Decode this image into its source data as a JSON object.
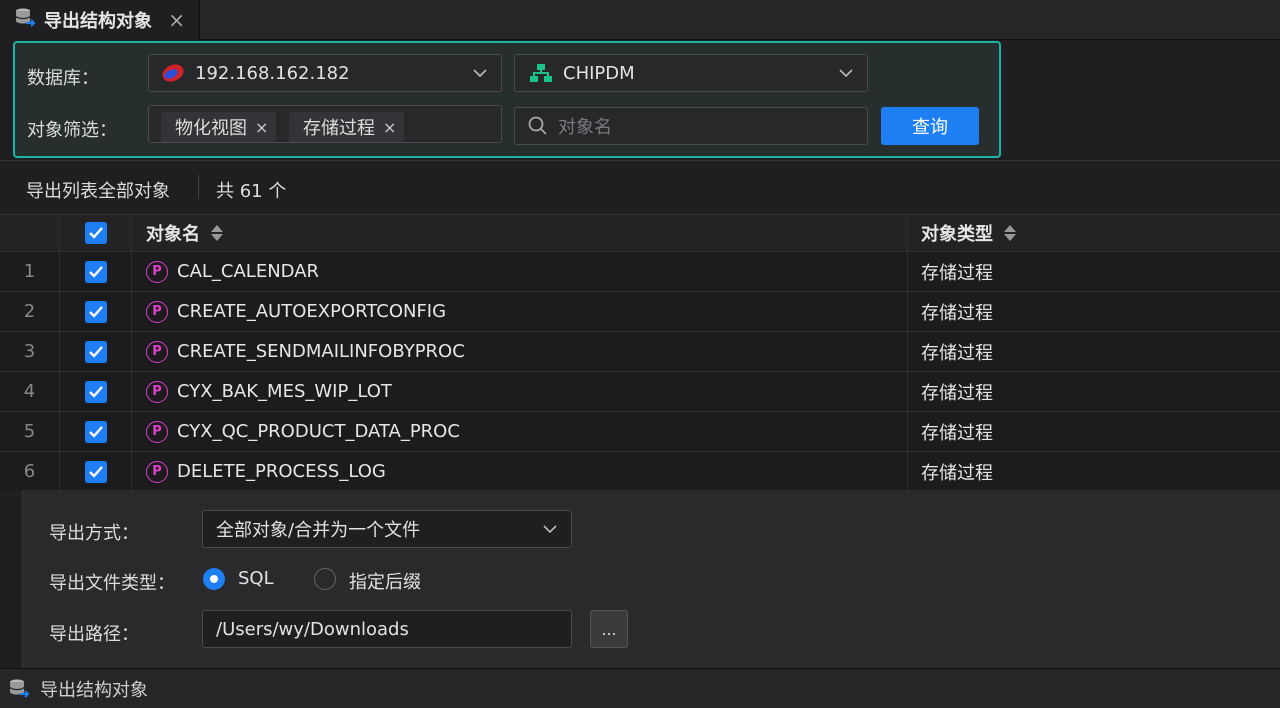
{
  "tab": {
    "title": "导出结构对象",
    "icon": "database-export-icon",
    "close": "×"
  },
  "filter": {
    "db_label": "数据库：",
    "db_value": "192.168.162.182",
    "schema_value": "CHIPDM",
    "obj_label": "对象筛选：",
    "chips": [
      "物化视图",
      "存储过程"
    ],
    "chip_close": "×",
    "search_placeholder": "对象名",
    "query_button": "查询"
  },
  "summary": {
    "export_all": "导出列表全部对象",
    "count": "共 61 个"
  },
  "table": {
    "columns": {
      "name": "对象名",
      "type": "对象类型"
    },
    "type_icon_letter": "P",
    "rows": [
      {
        "idx": "1",
        "name": "CAL_CALENDAR",
        "type": "存储过程"
      },
      {
        "idx": "2",
        "name": "CREATE_AUTOEXPORTCONFIG",
        "type": "存储过程"
      },
      {
        "idx": "3",
        "name": "CREATE_SENDMAILINFOBYPROC",
        "type": "存储过程"
      },
      {
        "idx": "4",
        "name": "CYX_BAK_MES_WIP_LOT",
        "type": "存储过程"
      },
      {
        "idx": "5",
        "name": "CYX_QC_PRODUCT_DATA_PROC",
        "type": "存储过程"
      },
      {
        "idx": "6",
        "name": "DELETE_PROCESS_LOG",
        "type": "存储过程"
      }
    ]
  },
  "options": {
    "method_label": "导出方式：",
    "method_value": "全部对象/合并为一个文件",
    "filetype_label": "导出文件类型：",
    "radio_sql": "SQL",
    "radio_suffix": "指定后缀",
    "selected_radio": "SQL",
    "path_label": "导出路径：",
    "path_value": "/Users/wy/Downloads",
    "browse_label": "..."
  },
  "statusbar": {
    "text": "导出结构对象"
  },
  "colors": {
    "accent": "#1e7ff5",
    "panel_border": "#1bb5a6",
    "procedure_icon": "#e040c8"
  }
}
